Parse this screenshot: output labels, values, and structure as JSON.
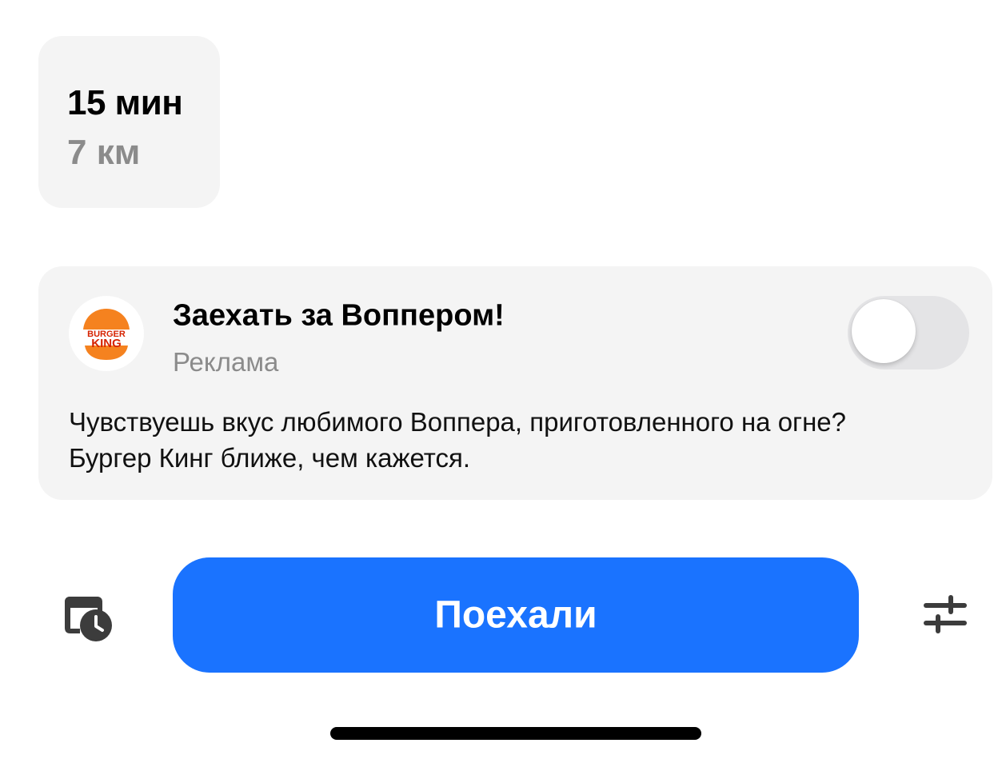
{
  "route": {
    "duration": "15 мин",
    "distance": "7 км"
  },
  "promo": {
    "logo_icon": "burger-king-logo",
    "logo_text_line1": "BURGER",
    "logo_text_line2": "KING",
    "title": "Заехать за Воппером!",
    "subtitle": "Реклама",
    "toggle_on": false,
    "description_line1": "Чувствуешь вкус любимого Воппера, приготовленного на огне?",
    "description_line2": "Бургер Кинг ближе, чем кажется."
  },
  "actions": {
    "schedule_icon": "calendar-clock-icon",
    "go_label": "Поехали",
    "options_icon": "sliders-icon"
  },
  "colors": {
    "accent": "#1a73ff",
    "card_background": "#f4f4f4",
    "secondary_text": "#8b8b8b",
    "toggle_off": "#e4e4e6",
    "bk_orange": "#f5821f",
    "bk_red": "#d62300"
  }
}
